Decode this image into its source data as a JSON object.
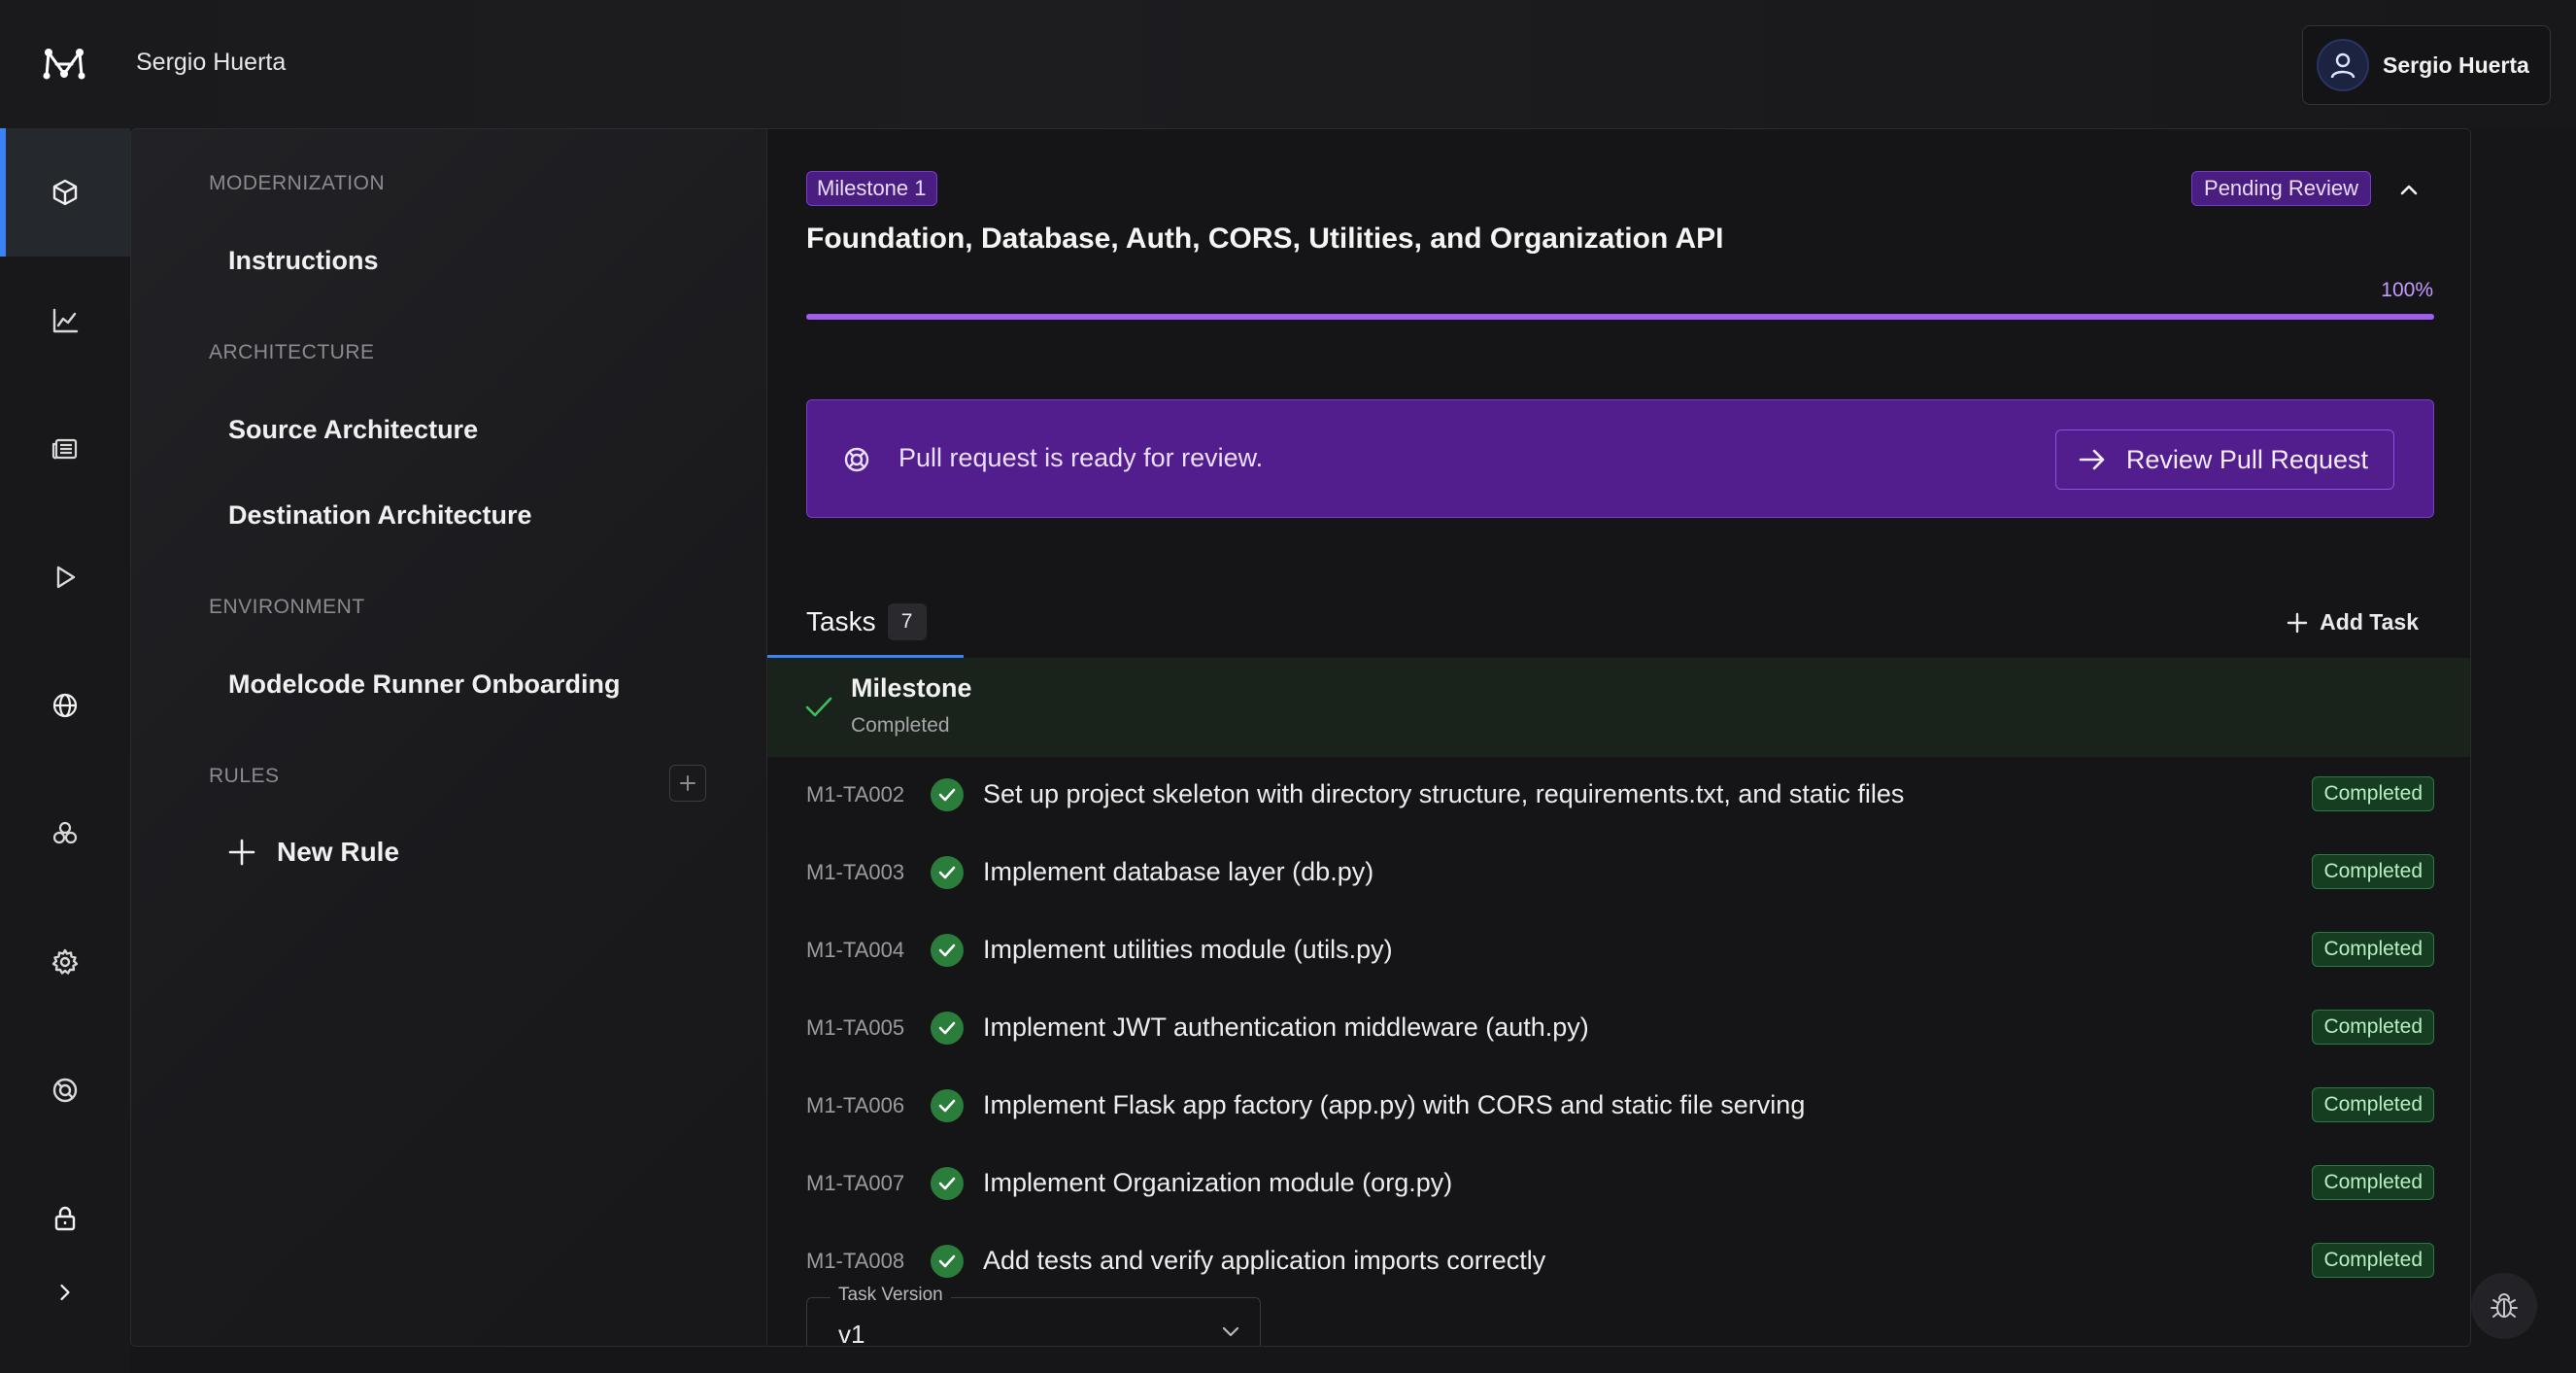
{
  "header": {
    "org_name": "Sergio Huerta",
    "user_name": "Sergio Huerta"
  },
  "rail": {
    "items": [
      {
        "icon": "cube-icon",
        "active": true
      },
      {
        "icon": "line-chart-icon",
        "active": false
      },
      {
        "icon": "newspaper-icon",
        "active": false
      },
      {
        "icon": "play-icon",
        "active": false
      },
      {
        "icon": "globe-icon",
        "active": false
      },
      {
        "icon": "users-icon",
        "active": false
      },
      {
        "icon": "gear-icon",
        "active": false
      },
      {
        "icon": "lifebuoy-icon",
        "active": false
      },
      {
        "icon": "lock-icon",
        "active": false
      },
      {
        "icon": "chevron-right-icon",
        "active": false
      }
    ]
  },
  "sidebar": {
    "sections": [
      {
        "label": "MODERNIZATION",
        "items": [
          "Instructions"
        ]
      },
      {
        "label": "ARCHITECTURE",
        "items": [
          "Source Architecture",
          "Destination Architecture"
        ]
      },
      {
        "label": "ENVIRONMENT",
        "items": [
          "Modelcode Runner Onboarding"
        ]
      },
      {
        "label": "RULES",
        "items": []
      }
    ],
    "new_rule_label": "New Rule"
  },
  "milestone": {
    "badge": "Milestone 1",
    "status": "Pending Review",
    "title": "Foundation, Database, Auth, CORS, Utilities, and Organization API",
    "progress_label": "100%",
    "progress": 1.0,
    "accent_color": "#a15cf0"
  },
  "pr_banner": {
    "text": "Pull request is ready for review.",
    "button_label": "Review Pull Request"
  },
  "tabs": {
    "tasks_label": "Tasks",
    "tasks_count": "7",
    "add_task_label": "Add Task"
  },
  "milestone_row": {
    "title": "Milestone",
    "status": "Completed"
  },
  "tasks": [
    {
      "id": "M1-TA002",
      "title": "Set up project skeleton with directory structure, requirements.txt, and static files",
      "status": "Completed"
    },
    {
      "id": "M1-TA003",
      "title": "Implement database layer (db.py)",
      "status": "Completed"
    },
    {
      "id": "M1-TA004",
      "title": "Implement utilities module (utils.py)",
      "status": "Completed"
    },
    {
      "id": "M1-TA005",
      "title": "Implement JWT authentication middleware (auth.py)",
      "status": "Completed"
    },
    {
      "id": "M1-TA006",
      "title": "Implement Flask app factory (app.py) with CORS and static file serving",
      "status": "Completed"
    },
    {
      "id": "M1-TA007",
      "title": "Implement Organization module (org.py)",
      "status": "Completed"
    },
    {
      "id": "M1-TA008",
      "title": "Add tests and verify application imports correctly",
      "status": "Completed"
    }
  ],
  "task_version": {
    "label": "Task Version",
    "value": "v1"
  },
  "colors": {
    "completed_green": "#2a7d3b",
    "active_blue": "#3b82f6"
  }
}
